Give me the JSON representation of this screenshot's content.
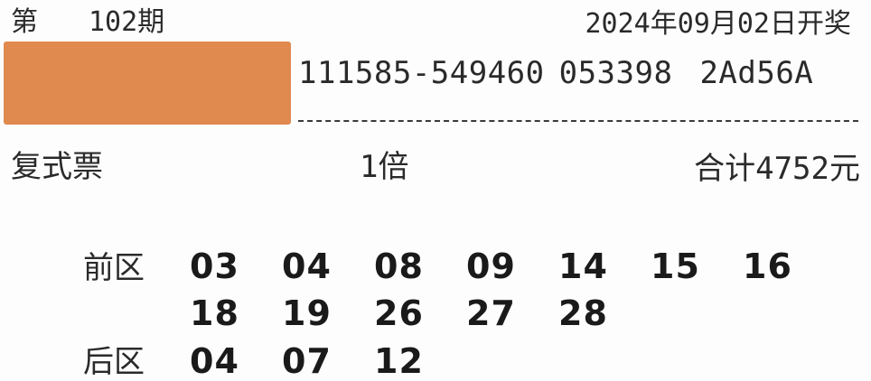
{
  "header": {
    "issue_prefix": "第",
    "issue_number": "102期",
    "draw_date": "2024年09月02日开奖"
  },
  "serial": {
    "part1": "111585-549460",
    "part2": "053398",
    "part3": "2Ad56A"
  },
  "ticket": {
    "type": "复式票",
    "multiple": "1倍",
    "total": "合计4752元"
  },
  "front_zone": {
    "label": "前区",
    "rows": [
      [
        "03",
        "04",
        "08",
        "09",
        "14",
        "15",
        "16"
      ],
      [
        "18",
        "19",
        "26",
        "27",
        "28"
      ]
    ]
  },
  "back_zone": {
    "label": "后区",
    "numbers": [
      "04",
      "07",
      "12"
    ]
  },
  "colors": {
    "redaction": "#e08a4f",
    "paper": "#fdfdfd",
    "ink": "#1e1e1e"
  }
}
